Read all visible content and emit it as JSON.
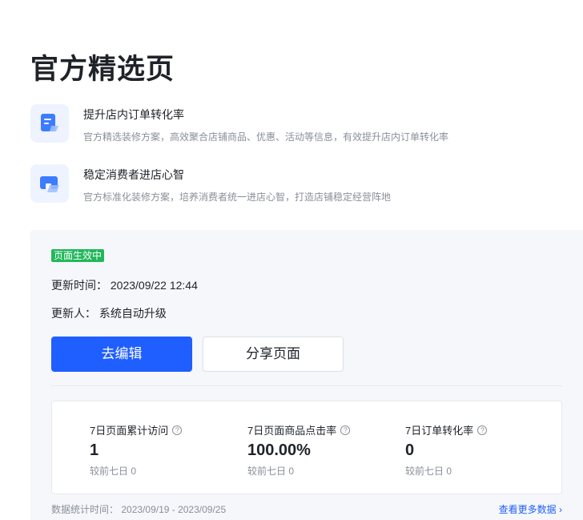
{
  "page": {
    "title": "官方精选页"
  },
  "features": [
    {
      "title": "提升店内订单转化率",
      "desc": "官方精选装修方案，高效聚合店铺商品、优惠、活动等信息，有效提升店内订单转化率",
      "icon": "document-icon"
    },
    {
      "title": "稳定消费者进店心智",
      "desc": "官方标准化装修方案，培养消费者统一进店心智，打造店铺稳定经营阵地",
      "icon": "store-icon"
    }
  ],
  "panel": {
    "status": "页面生效中",
    "update_time_label": "更新时间：",
    "update_time_value": "2023/09/22 12:44",
    "updater_label": "更新人：",
    "updater_value": "系统自动升级",
    "edit_button": "去编辑",
    "share_button": "分享页面"
  },
  "stats": [
    {
      "label": "7日页面累计访问",
      "value": "1",
      "compare_label": "较前七日",
      "compare_value": "0"
    },
    {
      "label": "7日页面商品点击率",
      "value": "100.00%",
      "compare_label": "较前七日",
      "compare_value": "0"
    },
    {
      "label": "7日订单转化率",
      "value": "0",
      "compare_label": "较前七日",
      "compare_value": "0"
    }
  ],
  "footer": {
    "time_label": "数据统计时间：",
    "time_value": "2023/09/19 - 2023/09/25",
    "more_link": "查看更多数据",
    "more_chevron": "›"
  },
  "colors": {
    "accent": "#1f5eff",
    "success": "#21b75a",
    "panel_bg": "#f5f7fa"
  }
}
